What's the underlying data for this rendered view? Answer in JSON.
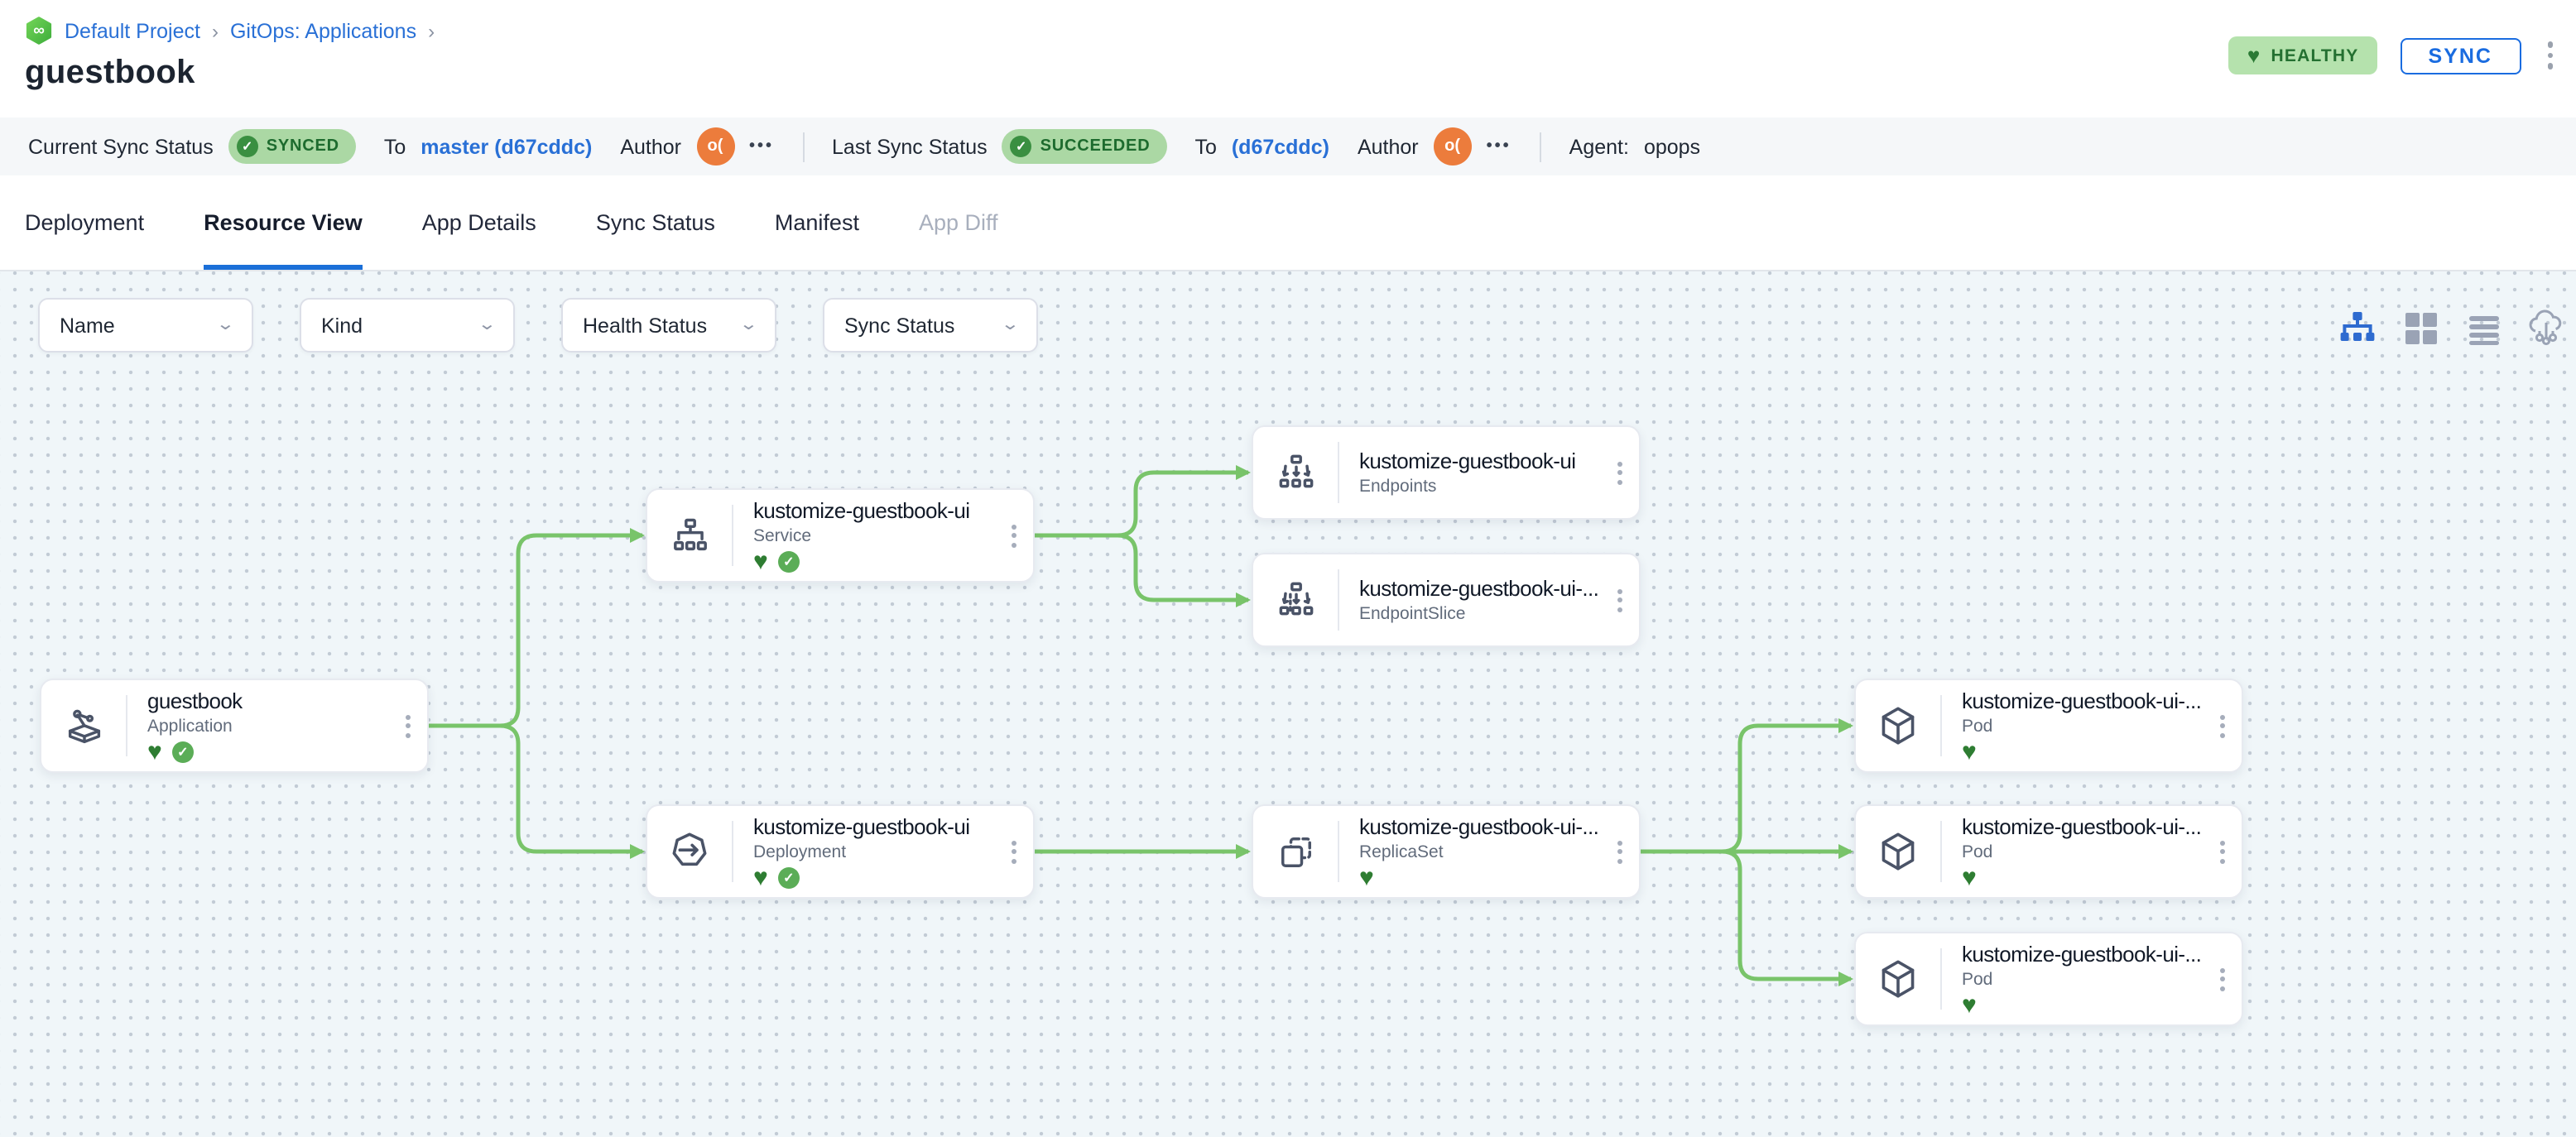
{
  "breadcrumb": {
    "logo_glyph": "∞",
    "project": "Default Project",
    "separator": "›",
    "section": "GitOps: Applications"
  },
  "page": {
    "title": "guestbook"
  },
  "header": {
    "health_badge": "HEALTHY",
    "health_heart_icon": "♥",
    "sync_button": "SYNC"
  },
  "status_bar": {
    "current": {
      "label": "Current Sync Status",
      "badge": "SYNCED",
      "badge_check_icon": "✓",
      "to_label": "To",
      "revision": "master (d67cddc)",
      "author_label": "Author",
      "author_initials": "o(",
      "more": "•••"
    },
    "last": {
      "label": "Last Sync Status",
      "badge": "SUCCEEDED",
      "badge_check_icon": "✓",
      "to_label": "To",
      "revision": "(d67cddc)",
      "author_label": "Author",
      "author_initials": "o(",
      "more": "•••"
    },
    "agent": {
      "label": "Agent:",
      "value": "opops"
    }
  },
  "tabs": [
    {
      "label": "Deployment",
      "state": "normal"
    },
    {
      "label": "Resource View",
      "state": "active"
    },
    {
      "label": "App Details",
      "state": "normal"
    },
    {
      "label": "Sync Status",
      "state": "normal"
    },
    {
      "label": "Manifest",
      "state": "normal"
    },
    {
      "label": "App Diff",
      "state": "disabled"
    }
  ],
  "filters": [
    {
      "label": "Name"
    },
    {
      "label": "Kind"
    },
    {
      "label": "Health Status"
    },
    {
      "label": "Sync Status"
    }
  ],
  "view_toggles": [
    {
      "name": "tree-view-icon",
      "active": true
    },
    {
      "name": "grid-view-icon",
      "active": false
    },
    {
      "name": "list-view-icon",
      "active": false
    },
    {
      "name": "cluster-view-icon",
      "active": false
    }
  ],
  "colors": {
    "edge_green": "#79c46a",
    "accent_blue": "#1b6fd8",
    "healthy_green": "#2e7d32",
    "badge_bg": "#abd8a4",
    "avatar_orange": "#ec7c3c",
    "canvas_bg": "#f0f6f9"
  },
  "graph": {
    "nodes": [
      {
        "id": "app",
        "title": "guestbook",
        "kind": "Application",
        "icon": "application-icon",
        "healthy": true,
        "synced": true
      },
      {
        "id": "svc",
        "title": "kustomize-guestbook-ui",
        "kind": "Service",
        "icon": "service-icon",
        "healthy": true,
        "synced": true
      },
      {
        "id": "ep",
        "title": "kustomize-guestbook-ui",
        "kind": "Endpoints",
        "icon": "endpoints-icon",
        "healthy": false,
        "synced": false
      },
      {
        "id": "eps",
        "title": "kustomize-guestbook-ui-...",
        "kind": "EndpointSlice",
        "icon": "endpointslice-icon",
        "healthy": false,
        "synced": false
      },
      {
        "id": "dep",
        "title": "kustomize-guestbook-ui",
        "kind": "Deployment",
        "icon": "deployment-icon",
        "healthy": true,
        "synced": true
      },
      {
        "id": "rs",
        "title": "kustomize-guestbook-ui-...",
        "kind": "ReplicaSet",
        "icon": "replicaset-icon",
        "healthy": true,
        "synced": false
      },
      {
        "id": "pod1",
        "title": "kustomize-guestbook-ui-...",
        "kind": "Pod",
        "icon": "pod-icon",
        "healthy": true,
        "synced": false
      },
      {
        "id": "pod2",
        "title": "kustomize-guestbook-ui-...",
        "kind": "Pod",
        "icon": "pod-icon",
        "healthy": true,
        "synced": false
      },
      {
        "id": "pod3",
        "title": "kustomize-guestbook-ui-...",
        "kind": "Pod",
        "icon": "pod-icon",
        "healthy": true,
        "synced": false
      }
    ],
    "edges": [
      {
        "from": "app",
        "to": "svc"
      },
      {
        "from": "app",
        "to": "dep"
      },
      {
        "from": "svc",
        "to": "ep"
      },
      {
        "from": "svc",
        "to": "eps"
      },
      {
        "from": "dep",
        "to": "rs"
      },
      {
        "from": "rs",
        "to": "pod1"
      },
      {
        "from": "rs",
        "to": "pod2"
      },
      {
        "from": "rs",
        "to": "pod3"
      }
    ]
  }
}
